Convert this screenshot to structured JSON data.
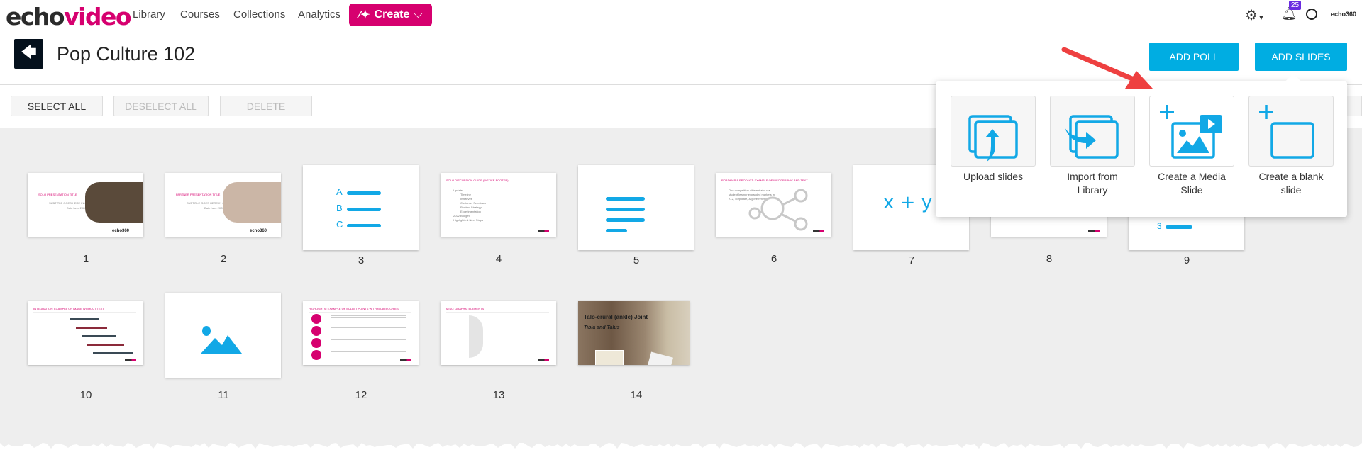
{
  "header": {
    "logo_part1": "echo",
    "logo_part2": "video",
    "nav": [
      "Library",
      "Courses",
      "Collections",
      "Analytics"
    ],
    "create_label": "Create",
    "notification_count": "25",
    "brand_small": "echo360"
  },
  "page": {
    "title": "Pop Culture 102",
    "add_poll": "ADD POLL",
    "add_slides": "ADD SLIDES"
  },
  "toolbar": {
    "select_all": "SELECT ALL",
    "deselect_all": "DESELECT ALL",
    "delete": "DELETE"
  },
  "popup": {
    "options": [
      "Upload slides",
      "Import from Library",
      "Create a Media Slide",
      "Create a blank slide"
    ]
  },
  "colors": {
    "brand": "#d6006f",
    "accent": "#00ade2",
    "annotation_arrow": "#ee4040"
  },
  "slides": [
    {
      "n": "1",
      "type": "title",
      "title": "SOLO PRESENTATION TITLE",
      "sub": "SUBTITLE GOES HERE IN CAPS",
      "date": "Date here 2022",
      "brand": "echo360"
    },
    {
      "n": "2",
      "type": "title",
      "title": "PARTNER PRESENTATION TITLE",
      "sub": "SUBTITLE GOES HERE IN CAPS",
      "date": "Date here 2022",
      "brand": "echo360"
    },
    {
      "n": "3",
      "type": "poll-abc",
      "letters": [
        "A",
        "B",
        "C"
      ]
    },
    {
      "n": "4",
      "type": "doc",
      "title": "SOLO DISCUSSION GUIDE (NOTICE FOOTER)",
      "lines": [
        "Update",
        "Timeline",
        "Initiatives",
        "Customer Feedback",
        "Product Strategy",
        "Experimentation",
        "2022 Budget",
        "Highlights & Next Steps"
      ]
    },
    {
      "n": "5",
      "type": "poll-text"
    },
    {
      "n": "6",
      "type": "doc",
      "title": "ROADMAP & PRODUCT: EXAMPLE OF INFOGRAPHIC AND TEXT",
      "lines": [
        "One competitive differentiator via",
        "student/learner expanded markets in",
        "K12, corporate, & government"
      ]
    },
    {
      "n": "7",
      "type": "poll-math",
      "text": "x + y"
    },
    {
      "n": "8",
      "type": "doc",
      "title": "",
      "lines": []
    },
    {
      "n": "9",
      "type": "poll-num",
      "text": "3"
    },
    {
      "n": "10",
      "type": "doc",
      "title": "INTEGRATION: EXAMPLE OF IMAGE WITHOUT TEXT",
      "lines": []
    },
    {
      "n": "11",
      "type": "poll-image"
    },
    {
      "n": "12",
      "type": "doc",
      "title": "HIGHLIGHTS: EXAMPLE OF BULLET POINTS WITHIN CATEGORIES",
      "lines": []
    },
    {
      "n": "13",
      "type": "doc",
      "title": "MISC: GRAPHIC ELEMENTS",
      "lines": []
    },
    {
      "n": "14",
      "type": "photo",
      "title": "Talo-crural (ankle) Joint",
      "sub": "Tibia and Talus"
    }
  ]
}
